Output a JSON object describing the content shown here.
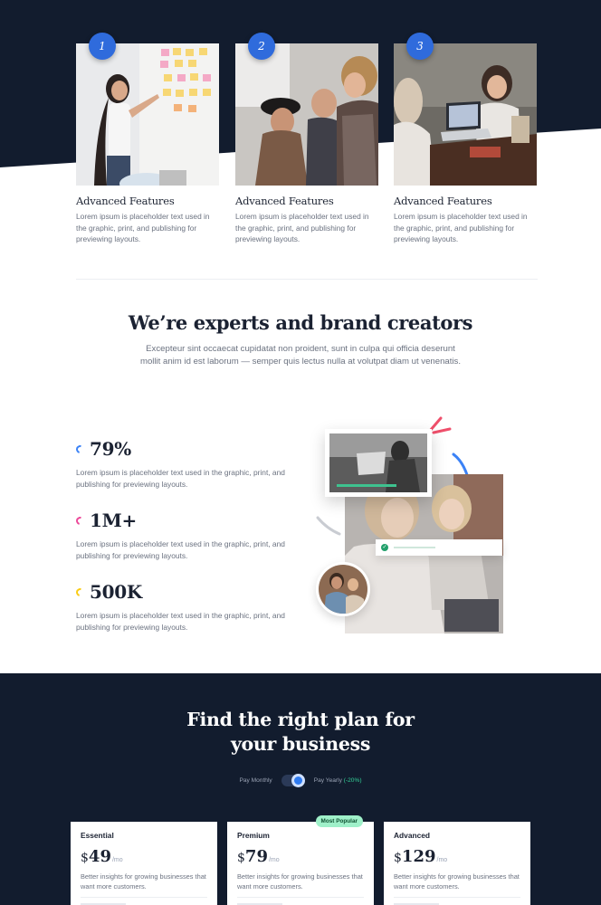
{
  "features": [
    {
      "number": "1",
      "title": "Advanced Features",
      "text": "Lorem ipsum is placeholder text used in the graphic, print, and publishing for previewing layouts."
    },
    {
      "number": "2",
      "title": "Advanced Features",
      "text": "Lorem ipsum is placeholder text used in the graphic, print, and publishing for previewing layouts."
    },
    {
      "number": "3",
      "title": "Advanced Features",
      "text": "Lorem ipsum is placeholder text used in the graphic, print, and publishing for previewing layouts."
    }
  ],
  "experts": {
    "title": "We’re experts and brand creators",
    "subtitle": "Excepteur sint occaecat cupidatat non proident, sunt in culpa qui officia deserunt mollit anim id est laborum — semper quis lectus nulla at volutpat diam ut venenatis."
  },
  "stats": [
    {
      "value": "79%",
      "color": "#3b82f6",
      "text": "Lorem ipsum is placeholder text used in the graphic, print, and publishing for previewing layouts."
    },
    {
      "value": "1M+",
      "color": "#ec4899",
      "text": "Lorem ipsum is placeholder text used in the graphic, print, and publishing for previewing layouts."
    },
    {
      "value": "500K",
      "color": "#facc15",
      "text": "Lorem ipsum is placeholder text used in the graphic, print, and publishing for previewing layouts."
    }
  ],
  "pricing": {
    "title": "Find the right plan for your business",
    "monthly_label": "Pay Monthly",
    "yearly_label": "Pay Yearly",
    "yearly_discount": "(-20%)",
    "plans": [
      {
        "name": "Essential",
        "currency": "$",
        "amount": "49",
        "per": "/mo",
        "desc": "Better insights for growing businesses that want more customers."
      },
      {
        "name": "Premium",
        "currency": "$",
        "amount": "79",
        "per": "/mo",
        "desc": "Better insights for growing businesses that want more customers.",
        "badge": "Most Popular"
      },
      {
        "name": "Advanced",
        "currency": "$",
        "amount": "129",
        "per": "/mo",
        "desc": "Better insights for growing businesses that want more customers."
      }
    ]
  },
  "colors": {
    "dark_navy": "#121c2e",
    "accent_blue": "#2f6bdc",
    "popular_green": "#9ff0c9"
  }
}
